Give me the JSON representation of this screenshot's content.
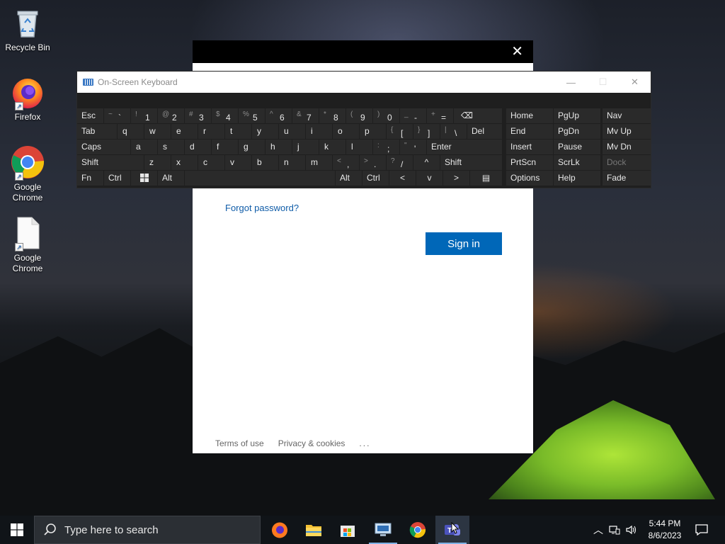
{
  "desktop": {
    "icons": [
      {
        "label": "Recycle Bin"
      },
      {
        "label": "Firefox"
      },
      {
        "label": "Google Chrome"
      },
      {
        "label": "Google Chrome"
      }
    ]
  },
  "login": {
    "forgot_password": "Forgot password?",
    "sign_in": "Sign in",
    "footer": {
      "terms": "Terms of use",
      "privacy": "Privacy & cookies",
      "more": "..."
    }
  },
  "osk": {
    "title": "On-Screen Keyboard",
    "row1": {
      "esc": "Esc",
      "tilde": {
        "shift": "~",
        "main": "`"
      },
      "k1": {
        "shift": "!",
        "main": "1"
      },
      "k2": {
        "shift": "@",
        "main": "2"
      },
      "k3": {
        "shift": "#",
        "main": "3"
      },
      "k4": {
        "shift": "$",
        "main": "4"
      },
      "k5": {
        "shift": "%",
        "main": "5"
      },
      "k6": {
        "shift": "^",
        "main": "6"
      },
      "k7": {
        "shift": "&",
        "main": "7"
      },
      "k8": {
        "shift": "*",
        "main": "8"
      },
      "k9": {
        "shift": "(",
        "main": "9"
      },
      "k0": {
        "shift": ")",
        "main": "0"
      },
      "minus": {
        "shift": "_",
        "main": "-"
      },
      "equal": {
        "shift": "+",
        "main": "="
      },
      "backspace": "⌫"
    },
    "row2": {
      "tab": "Tab",
      "letters": [
        "q",
        "w",
        "e",
        "r",
        "t",
        "y",
        "u",
        "i",
        "o",
        "p"
      ],
      "lbracket": {
        "shift": "{",
        "main": "["
      },
      "rbracket": {
        "shift": "}",
        "main": "]"
      },
      "backslash": {
        "shift": "|",
        "main": "\\"
      },
      "del": "Del"
    },
    "row3": {
      "caps": "Caps",
      "letters": [
        "a",
        "s",
        "d",
        "f",
        "g",
        "h",
        "j",
        "k",
        "l"
      ],
      "semicolon": {
        "shift": ":",
        "main": ";"
      },
      "quote": {
        "shift": "\"",
        "main": "'"
      },
      "enter": "Enter"
    },
    "row4": {
      "shift_left": "Shift",
      "letters": [
        "z",
        "x",
        "c",
        "v",
        "b",
        "n",
        "m"
      ],
      "comma": {
        "shift": "<",
        "main": ","
      },
      "period": {
        "shift": ">",
        "main": "."
      },
      "slash": {
        "shift": "?",
        "main": "/"
      },
      "up": "^",
      "shift_right": "Shift"
    },
    "row5": {
      "fn": "Fn",
      "ctrl_left": "Ctrl",
      "alt_left": "Alt",
      "alt_right": "Alt",
      "ctrl_right": "Ctrl",
      "left": "<",
      "down": "v",
      "right": ">",
      "menu": "▤"
    },
    "nav": {
      "col1": [
        "Home",
        "End",
        "Insert",
        "PrtScn",
        "Options"
      ],
      "col2": [
        "PgUp",
        "PgDn",
        "Pause",
        "ScrLk",
        "Help"
      ],
      "col3": [
        "Nav",
        "Mv Up",
        "Mv Dn",
        "Dock",
        "Fade"
      ]
    }
  },
  "taskbar": {
    "search_placeholder": "Type here to search",
    "time": "5:44 PM",
    "date": "8/6/2023"
  },
  "colors": {
    "signin_blue": "#0067b8",
    "link_blue": "#0f5ca8",
    "key_bg": "#2a2a2a",
    "osk_bg": "#1f1f1f",
    "taskbar_bg": "#101418"
  }
}
